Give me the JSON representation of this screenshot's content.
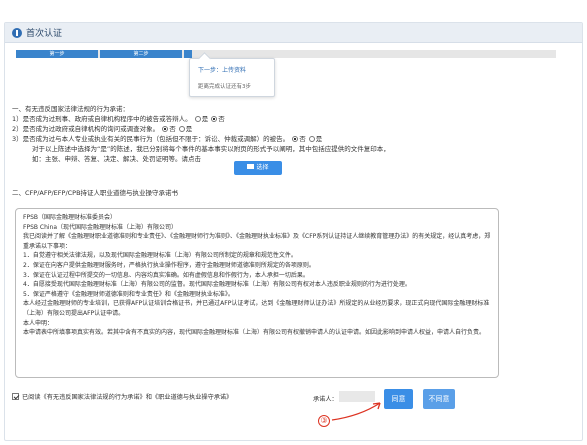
{
  "header": {
    "title": "首次认证"
  },
  "steps": {
    "step1": "第一步",
    "step2": "第二步"
  },
  "tooltip": {
    "next": "下一步：上传资料",
    "remain": "距离完成认证还有3步"
  },
  "section1": {
    "title": "一、有无违反国家法律法规的行为承诺：",
    "q1": "1）是否成为过刑事、政府或自律机构程序中的被告或答辩人。",
    "q2": "2）是否成为过政府或自律机构的询问或调查对象。",
    "q3a": "3）是否成为过与本人专业或执业有关的民事行为（包括但不限于：诉讼、仲裁或调解）的被告。",
    "q3b": "对于以上陈述中选择为“是”的陈述，我已分别将每个事件的基本事实以附页的形式予以阐明，其中包括应提供的文件复印本，",
    "q3c": "如：主张、申辩、答复、决定、解决、处罚证明等。请点击",
    "yes": "是",
    "no": "否"
  },
  "upload_label": "选择",
  "section2": {
    "title": "二、CFP/AFP/EFP/CPB持证人职业道德与执业操守承诺书"
  },
  "pledge": {
    "p1": "FPSB（国际金融理财标准委员会）",
    "p2": "FPSB China（现代国际金融理财标准（上海）有限公司）",
    "p3": "我已阅读并了解《金融理财职业道德准则和专业责任》、《金融理财师行为准则》、《金融理财执业标准》及《CFP系列认证持证人继续教育管理办法》的有关规定，经认真考虑，郑重承诺以下事项：",
    "p4": "1．自觉遵守相关法律法规，以及现代国际金融理财标准（上海）有限公司所制定的规章和规范性文件。",
    "p5": "2．保证在向客户提供金融理财服务时，严格执行执业操作程序，遵守金融理财师道德准则所规定的各项原则。",
    "p6": "3．保证在认证过程中所提交的一切信息、内容均真实准确。如有虚假信息和作假行为，本人承担一切后果。",
    "p7": "4．自愿接受现代国际金融理财标准（上海）有限公司的监督。现代国际金融理财标准（上海）有限公司有权对本人违反职业规则的行为进行处理。",
    "p8": "5．保证严格遵守《金融理财师道德准则和专业责任》和《金融理财执业标准》。",
    "p9": "本人经过金融理财师的专业培训，已获得AFP认证培训合格证书，并已通过AFP认证考试，达到《金融理财师认证办法》所规定的从业经历要求，现正式向现代国际金融理财标准（上海）有限公司提出AFP认证申请。",
    "p10": "本人申明：",
    "p11": "本申请表中所填事项真实有效。若其中含有不真实的内容，现代国际金融理财标准（上海）有限公司有权撤销申请人的认证申请。如因此影响到申请人权益，申请人自行负责。"
  },
  "agree_text": "已阅读《有无违反国家法律法规的行为承诺》和《职业道德与执业操守承诺》",
  "signer_label": "承诺人：",
  "buttons": {
    "agree": "同意",
    "disagree": "不同意"
  },
  "marker": "③"
}
